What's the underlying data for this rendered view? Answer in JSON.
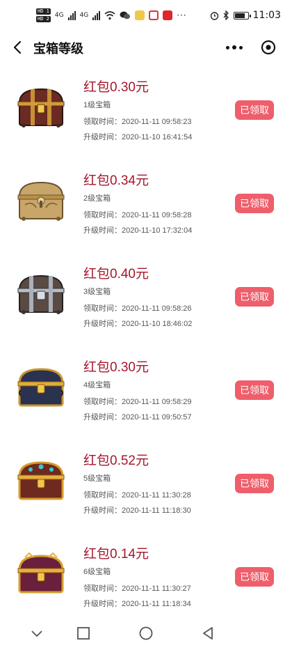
{
  "status_bar": {
    "time": "11:03",
    "hd1": "HD 1",
    "hd2": "HD 2",
    "net1": "4G",
    "net2": "4G"
  },
  "header": {
    "title": "宝箱等级"
  },
  "labels": {
    "claim_prefix": "领取时间：",
    "upgrade_prefix": "升级时间："
  },
  "items": [
    {
      "title": "红包0.30元",
      "level": "1级宝箱",
      "claim_time": "领取时间：2020-11-11 09:58:23",
      "upgrade_time": "升级时间：2020-11-10 16:41:54",
      "button": "已领取",
      "chest_color": "#6b2a22"
    },
    {
      "title": "红包0.34元",
      "level": "2级宝箱",
      "claim_time": "领取时间：2020-11-11 09:58:28",
      "upgrade_time": "升级时间：2020-11-10 17:32:04",
      "button": "已领取",
      "chest_color": "#c8a66a"
    },
    {
      "title": "红包0.40元",
      "level": "3级宝箱",
      "claim_time": "领取时间：2020-11-11 09:58:26",
      "upgrade_time": "升级时间：2020-11-10 18:46:02",
      "button": "已领取",
      "chest_color": "#5a4a44"
    },
    {
      "title": "红包0.30元",
      "level": "4级宝箱",
      "claim_time": "领取时间：2020-11-11 09:58:29",
      "upgrade_time": "升级时间：2020-11-11 09:50:57",
      "button": "已领取",
      "chest_color": "#2a3250"
    },
    {
      "title": "红包0.52元",
      "level": "5级宝箱",
      "claim_time": "领取时间：2020-11-11 11:30:28",
      "upgrade_time": "升级时间：2020-11-11 11:18:30",
      "button": "已领取",
      "chest_color": "#6e2a1e"
    },
    {
      "title": "红包0.14元",
      "level": "6级宝箱",
      "claim_time": "领取时间：2020-11-11 11:30:27",
      "upgrade_time": "升级时间：2020-11-11 11:18:34",
      "button": "已领取",
      "chest_color": "#6a1f3c"
    }
  ],
  "colors": {
    "accent": "#a5162b",
    "button": "#ee5f6b"
  }
}
